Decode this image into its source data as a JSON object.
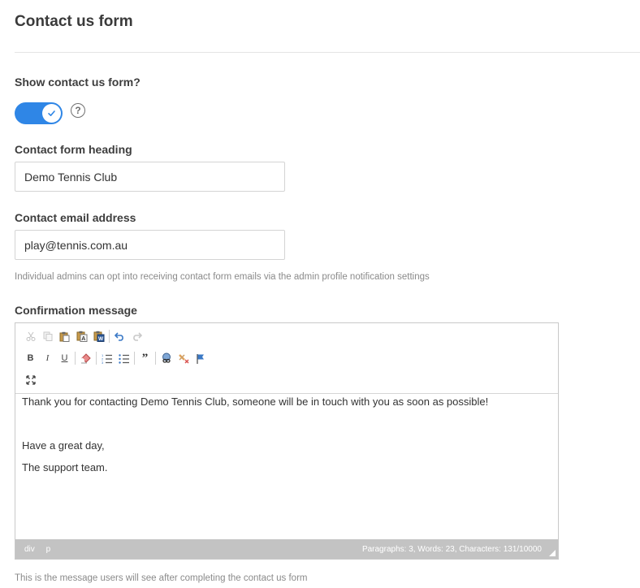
{
  "page_title": "Contact us form",
  "show_form": {
    "label": "Show contact us form?",
    "help_glyph": "?",
    "toggle_state": "on"
  },
  "heading_field": {
    "label": "Contact form heading",
    "value": "Demo Tennis Club"
  },
  "email_field": {
    "label": "Contact email address",
    "value": "play@tennis.com.au",
    "hint": "Individual admins can opt into receiving contact form emails via the admin profile notification settings"
  },
  "confirmation": {
    "label": "Confirmation message",
    "toolbar": {
      "row1": [
        {
          "name": "cut-icon",
          "glyph": "✂",
          "enabled": false
        },
        {
          "name": "copy-icon",
          "glyph": "⧉",
          "enabled": false
        },
        {
          "name": "paste-icon",
          "glyph": "📋",
          "enabled": true
        },
        {
          "name": "paste-text-icon",
          "glyph": "A",
          "enabled": true
        },
        {
          "name": "paste-word-icon",
          "glyph": "W",
          "enabled": true
        },
        {
          "name": "undo-icon",
          "glyph": "↶",
          "enabled": true
        },
        {
          "name": "redo-icon",
          "glyph": "↷",
          "enabled": false
        }
      ],
      "row2": [
        {
          "name": "bold-icon",
          "glyph": "B",
          "enabled": true
        },
        {
          "name": "italic-icon",
          "glyph": "I",
          "enabled": true
        },
        {
          "name": "underline-icon",
          "glyph": "U",
          "enabled": true
        },
        {
          "name": "remove-format-icon",
          "glyph": "⌫",
          "enabled": true
        },
        {
          "name": "numbered-list-icon",
          "glyph": "☰",
          "enabled": true
        },
        {
          "name": "bulleted-list-icon",
          "glyph": "☷",
          "enabled": true
        },
        {
          "name": "blockquote-icon",
          "glyph": "❞",
          "enabled": true
        },
        {
          "name": "link-icon",
          "glyph": "🔗",
          "enabled": true
        },
        {
          "name": "unlink-icon",
          "glyph": "✕",
          "enabled": true
        },
        {
          "name": "anchor-flag-icon",
          "glyph": "⚑",
          "enabled": true
        }
      ],
      "row3": [
        {
          "name": "maximize-icon",
          "glyph": "⤢",
          "enabled": true
        }
      ]
    },
    "body_lines": [
      "Thank you for contacting Demo Tennis Club, someone will be in touch with you as soon as possible!",
      "Have a great day,",
      "The support team."
    ],
    "status_path": [
      "div",
      "p"
    ],
    "status_counts": "Paragraphs: 3, Words: 23, Characters: 131/10000",
    "hint": "This is the message users will see after completing the contact us form"
  },
  "colors": {
    "toggle_on": "#2f86e6",
    "status_bar": "#c3c3c3",
    "accent_flag": "#3b79c6",
    "warning_red": "#d9534f"
  }
}
